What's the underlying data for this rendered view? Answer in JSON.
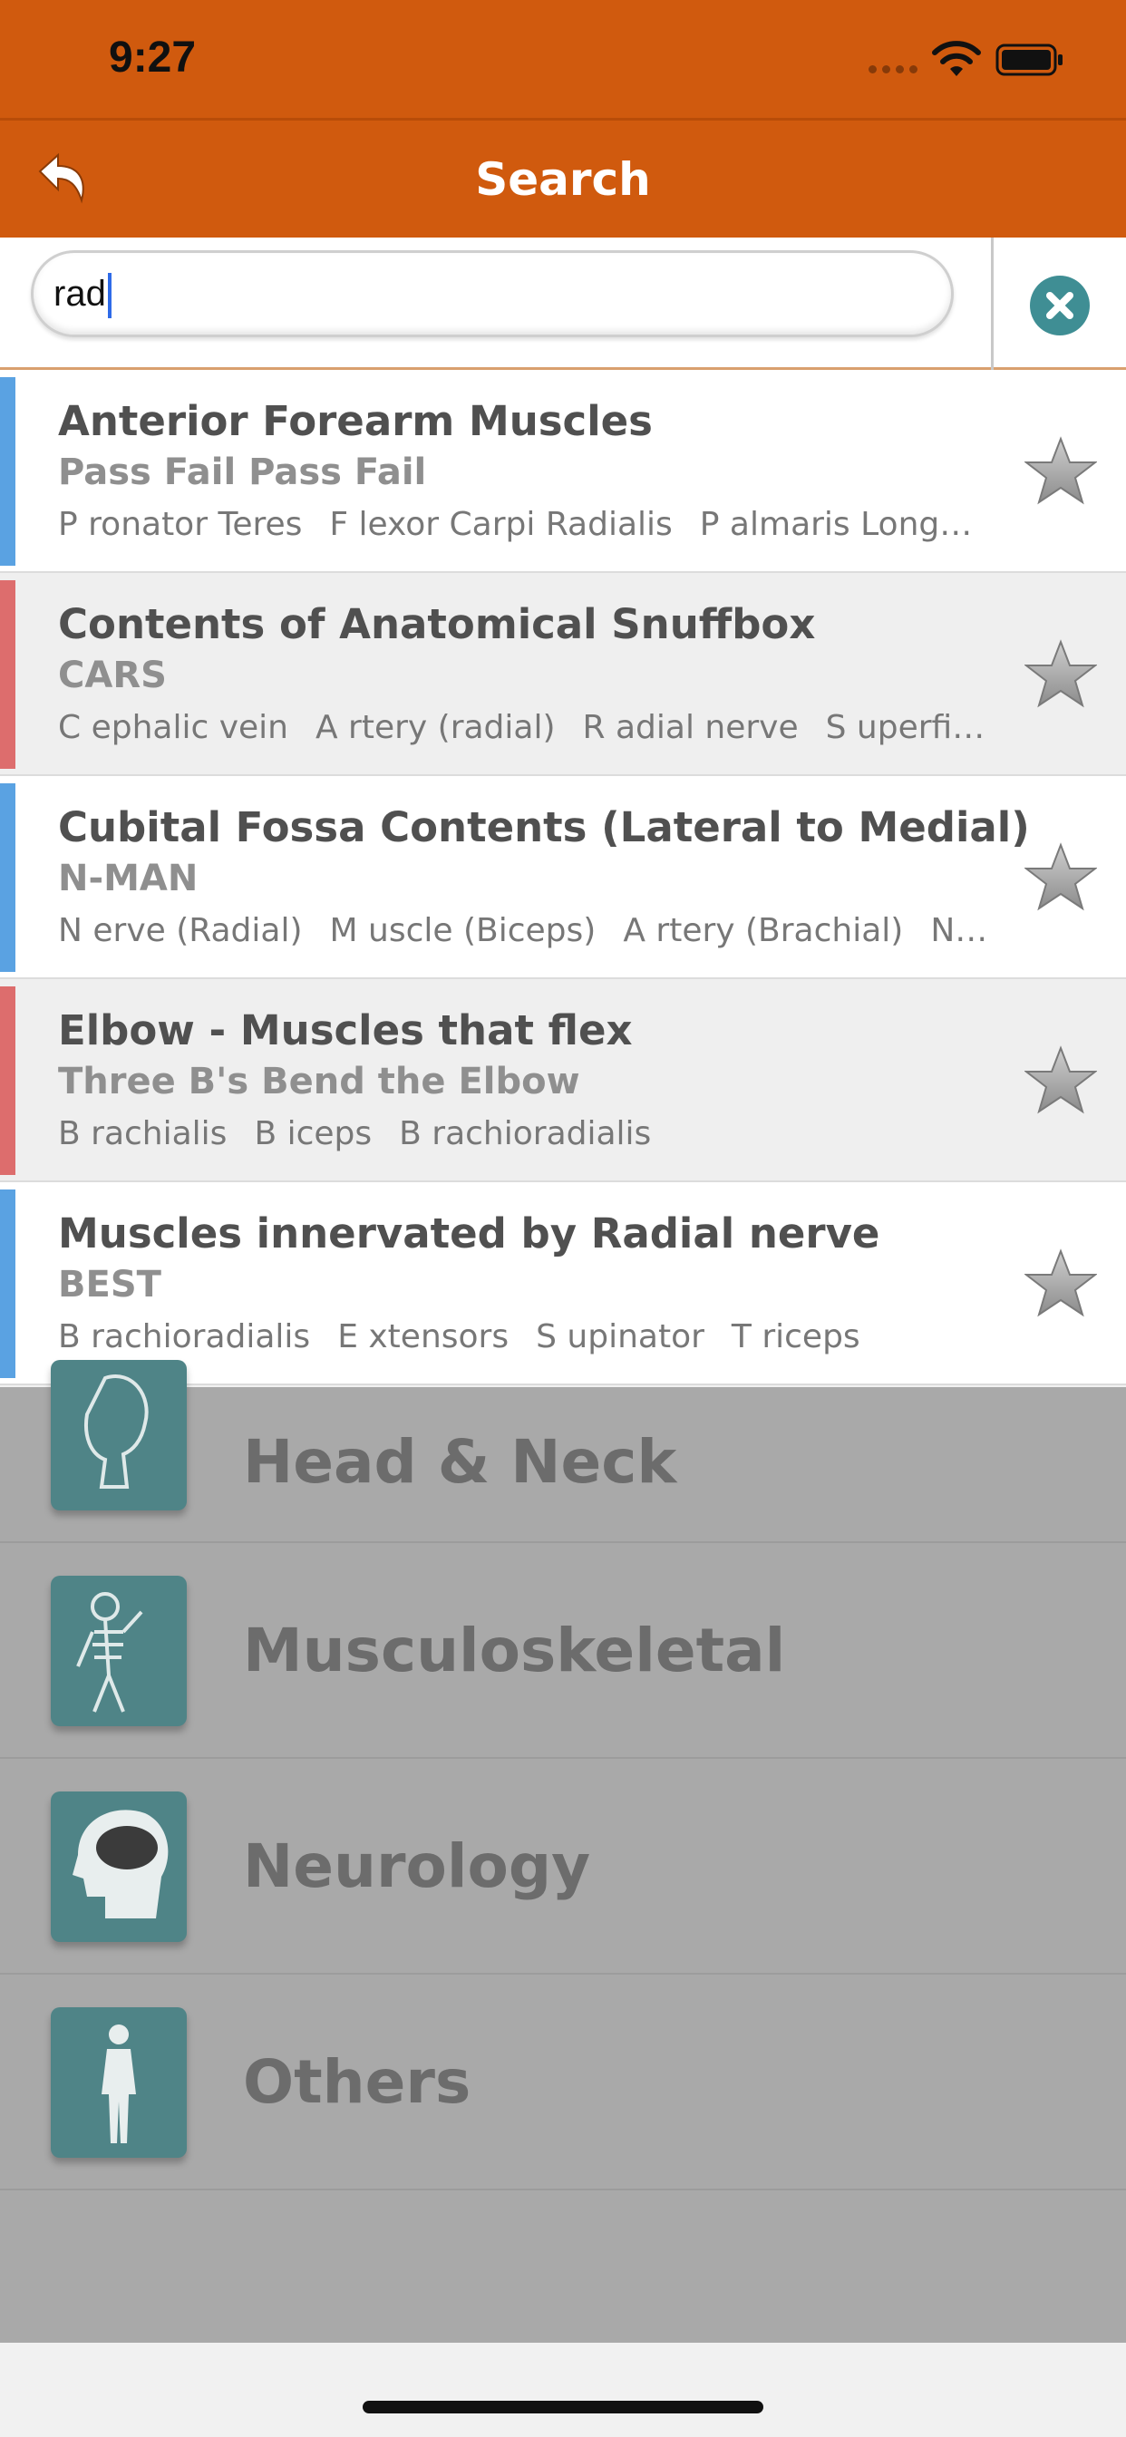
{
  "status_bar": {
    "time": "9:27"
  },
  "nav": {
    "title": "Search"
  },
  "search": {
    "value": "rad"
  },
  "results": [
    {
      "title": "Anterior Forearm Muscles",
      "subtitle": "Pass Fail Pass Fail",
      "items": [
        "P ronator Teres",
        "F lexor Carpi Radialis",
        "P almaris Longus..."
      ],
      "color": "#5aa2e2"
    },
    {
      "title": "Contents of Anatomical Snuffbox",
      "subtitle": "CARS",
      "items": [
        "C ephalic vein",
        "A rtery (radial)",
        "R adial nerve",
        "S uperficial..."
      ],
      "color": "#dd6d6d"
    },
    {
      "title": "Cubital Fossa Contents (Lateral to Medial)",
      "subtitle": "N-MAN",
      "items": [
        "N erve (Radial)",
        "M uscle (Biceps)",
        "A rtery (Brachial)",
        "N er..."
      ],
      "color": "#5aa2e2"
    },
    {
      "title": "Elbow - Muscles that flex",
      "subtitle": "Three B's Bend the Elbow",
      "items": [
        "B rachialis",
        "B iceps",
        "B rachioradialis"
      ],
      "color": "#dd6d6d"
    },
    {
      "title": "Muscles innervated by Radial nerve",
      "subtitle": "BEST",
      "items": [
        "B rachioradialis",
        "E xtensors",
        "S upinator",
        "T riceps"
      ],
      "color": "#5aa2e2"
    }
  ],
  "categories": [
    {
      "label": "Head & Neck",
      "icon": "head-neck-icon"
    },
    {
      "label": "Musculoskeletal",
      "icon": "skeleton-icon"
    },
    {
      "label": "Neurology",
      "icon": "brain-icon"
    },
    {
      "label": "Others",
      "icon": "body-icon"
    }
  ],
  "colors": {
    "accent": "#d05a0e",
    "teal": "#3f8e94"
  }
}
